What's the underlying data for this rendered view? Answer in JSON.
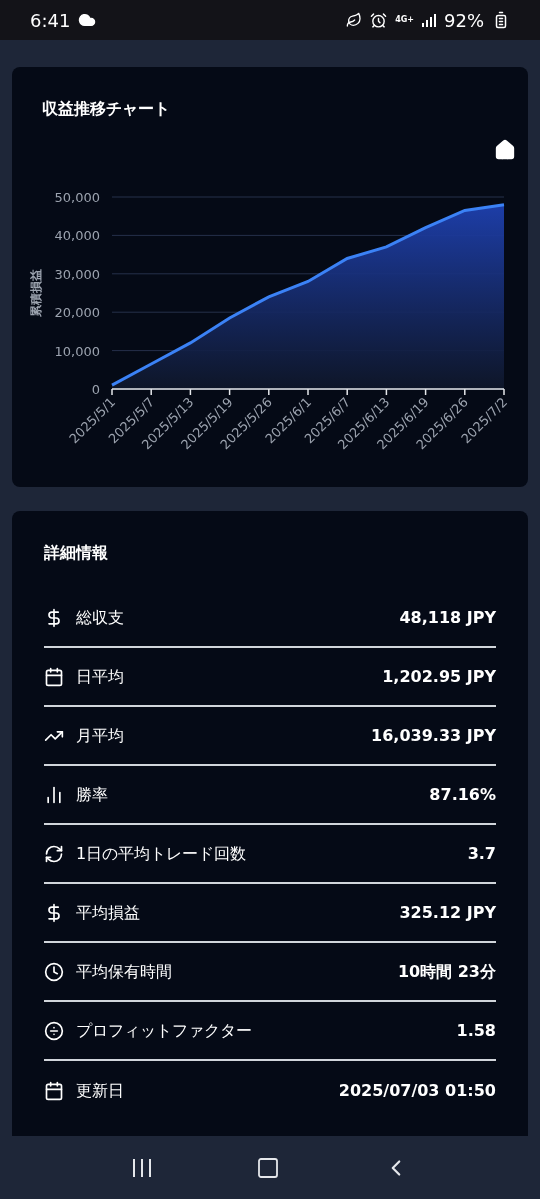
{
  "status_bar": {
    "time": "6:41",
    "network": "4G+",
    "battery": "92%"
  },
  "chart_card": {
    "title": "収益推移チャート",
    "chart_data": {
      "type": "area",
      "ylabel": "累積損益",
      "categories": [
        "2025/5/1",
        "2025/5/7",
        "2025/5/13",
        "2025/5/19",
        "2025/5/26",
        "2025/6/1",
        "2025/6/7",
        "2025/6/13",
        "2025/6/19",
        "2025/6/26",
        "2025/7/2"
      ],
      "series": [
        {
          "color": "#3b82f6",
          "values": [
            1000,
            6500,
            12000,
            18500,
            24000,
            28000,
            34000,
            37000,
            42000,
            46500,
            48000
          ]
        }
      ],
      "grid": true,
      "ylim": [
        0,
        50000
      ],
      "yticks": [
        {
          "value": 0,
          "label": "0"
        },
        {
          "value": 10000,
          "label": "10,000"
        },
        {
          "value": 20000,
          "label": "20,000"
        },
        {
          "value": 30000,
          "label": "30,000"
        },
        {
          "value": 40000,
          "label": "40,000"
        },
        {
          "value": 50000,
          "label": "50,000"
        }
      ]
    }
  },
  "details": {
    "title": "詳細情報",
    "rows": [
      {
        "kind": "money",
        "label": "総収支",
        "value": "48,118 JPY"
      },
      {
        "kind": "calendar",
        "label": "日平均",
        "value": "1,202.95 JPY"
      },
      {
        "kind": "trend",
        "label": "月平均",
        "value": "16,039.33 JPY"
      },
      {
        "kind": "bars",
        "label": "勝率",
        "value": "87.16%"
      },
      {
        "kind": "refresh",
        "label": "1日の平均トレード回数",
        "value": "3.7"
      },
      {
        "kind": "money",
        "label": "平均損益",
        "value": "325.12 JPY"
      },
      {
        "kind": "clock",
        "label": "平均保有時間",
        "value": "10時間 23分"
      },
      {
        "kind": "divide",
        "label": "プロフィットファクター",
        "value": "1.58"
      },
      {
        "kind": "calendar",
        "label": "更新日",
        "value": "2025/07/03 01:50"
      }
    ]
  }
}
